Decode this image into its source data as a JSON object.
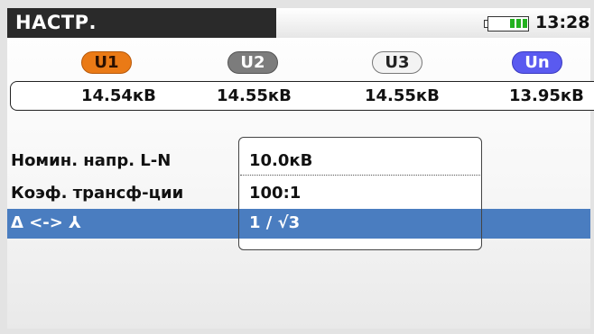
{
  "header": {
    "title": "НАСТР.",
    "time": "13:28",
    "battery_icon": "battery-icon",
    "battery_color": "#23b11f"
  },
  "channels": [
    {
      "label": "U1",
      "value": "14.54кВ",
      "color": "#ea7a16"
    },
    {
      "label": "U2",
      "value": "14.55кВ",
      "color": "#7c7c7c"
    },
    {
      "label": "U3",
      "value": "14.55кВ",
      "color": "#f3f3f3"
    },
    {
      "label": "Un",
      "value": "13.95кВ",
      "color": "#5a5af0"
    }
  ],
  "settings": [
    {
      "label": "Номин. напр. L-N",
      "value": "10.0кВ"
    },
    {
      "label": "Коэф. трансф-ции",
      "value": "100:1"
    },
    {
      "label": "Δ <-> ⅄",
      "value": "1 / √3",
      "selected": true
    }
  ],
  "selection_color": "#4a7dc0"
}
